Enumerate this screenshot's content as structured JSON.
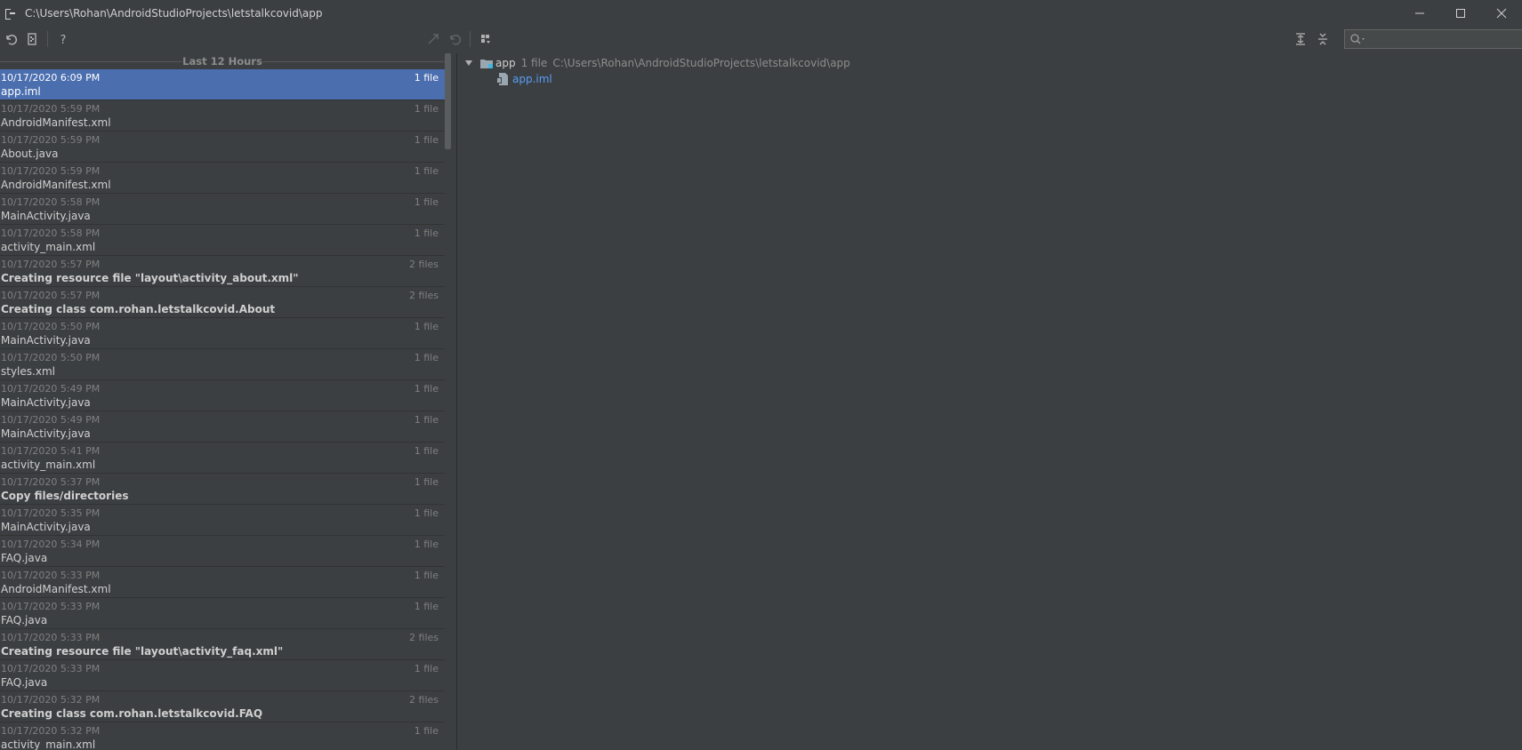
{
  "window": {
    "title": "C:\\Users\\Rohan\\AndroidStudioProjects\\letstalkcovid\\app"
  },
  "history": {
    "group_label": "Last 12 Hours",
    "rows": [
      {
        "time": "10/17/2020 6:09 PM",
        "count": "1 file",
        "name": "app.iml",
        "bold": false
      },
      {
        "time": "10/17/2020 5:59 PM",
        "count": "1 file",
        "name": "AndroidManifest.xml",
        "bold": false
      },
      {
        "time": "10/17/2020 5:59 PM",
        "count": "1 file",
        "name": "About.java",
        "bold": false
      },
      {
        "time": "10/17/2020 5:59 PM",
        "count": "1 file",
        "name": "AndroidManifest.xml",
        "bold": false
      },
      {
        "time": "10/17/2020 5:58 PM",
        "count": "1 file",
        "name": "MainActivity.java",
        "bold": false
      },
      {
        "time": "10/17/2020 5:58 PM",
        "count": "1 file",
        "name": "activity_main.xml",
        "bold": false
      },
      {
        "time": "10/17/2020 5:57 PM",
        "count": "2 files",
        "name": "Creating resource file \"layout\\activity_about.xml\"",
        "bold": true
      },
      {
        "time": "10/17/2020 5:57 PM",
        "count": "2 files",
        "name": "Creating class com.rohan.letstalkcovid.About",
        "bold": true
      },
      {
        "time": "10/17/2020 5:50 PM",
        "count": "1 file",
        "name": "MainActivity.java",
        "bold": false
      },
      {
        "time": "10/17/2020 5:50 PM",
        "count": "1 file",
        "name": "styles.xml",
        "bold": false
      },
      {
        "time": "10/17/2020 5:49 PM",
        "count": "1 file",
        "name": "MainActivity.java",
        "bold": false
      },
      {
        "time": "10/17/2020 5:49 PM",
        "count": "1 file",
        "name": "MainActivity.java",
        "bold": false
      },
      {
        "time": "10/17/2020 5:41 PM",
        "count": "1 file",
        "name": "activity_main.xml",
        "bold": false
      },
      {
        "time": "10/17/2020 5:37 PM",
        "count": "1 file",
        "name": "Copy files/directories",
        "bold": true
      },
      {
        "time": "10/17/2020 5:35 PM",
        "count": "1 file",
        "name": "MainActivity.java",
        "bold": false
      },
      {
        "time": "10/17/2020 5:34 PM",
        "count": "1 file",
        "name": "FAQ.java",
        "bold": false
      },
      {
        "time": "10/17/2020 5:33 PM",
        "count": "1 file",
        "name": "AndroidManifest.xml",
        "bold": false
      },
      {
        "time": "10/17/2020 5:33 PM",
        "count": "1 file",
        "name": "FAQ.java",
        "bold": false
      },
      {
        "time": "10/17/2020 5:33 PM",
        "count": "2 files",
        "name": "Creating resource file \"layout\\activity_faq.xml\"",
        "bold": true
      },
      {
        "time": "10/17/2020 5:33 PM",
        "count": "1 file",
        "name": "FAQ.java",
        "bold": false
      },
      {
        "time": "10/17/2020 5:32 PM",
        "count": "2 files",
        "name": "Creating class com.rohan.letstalkcovid.FAQ",
        "bold": true
      },
      {
        "time": "10/17/2020 5:32 PM",
        "count": "1 file",
        "name": "activity_main.xml",
        "bold": false
      }
    ]
  },
  "tree": {
    "root_name": "app",
    "root_count": "1 file",
    "root_path": "C:\\Users\\Rohan\\AndroidStudioProjects\\letstalkcovid\\app",
    "child_name": "app.iml"
  },
  "colors": {
    "background": "#3c3f41",
    "selection": "#4b6eaf",
    "link": "#589df6"
  }
}
